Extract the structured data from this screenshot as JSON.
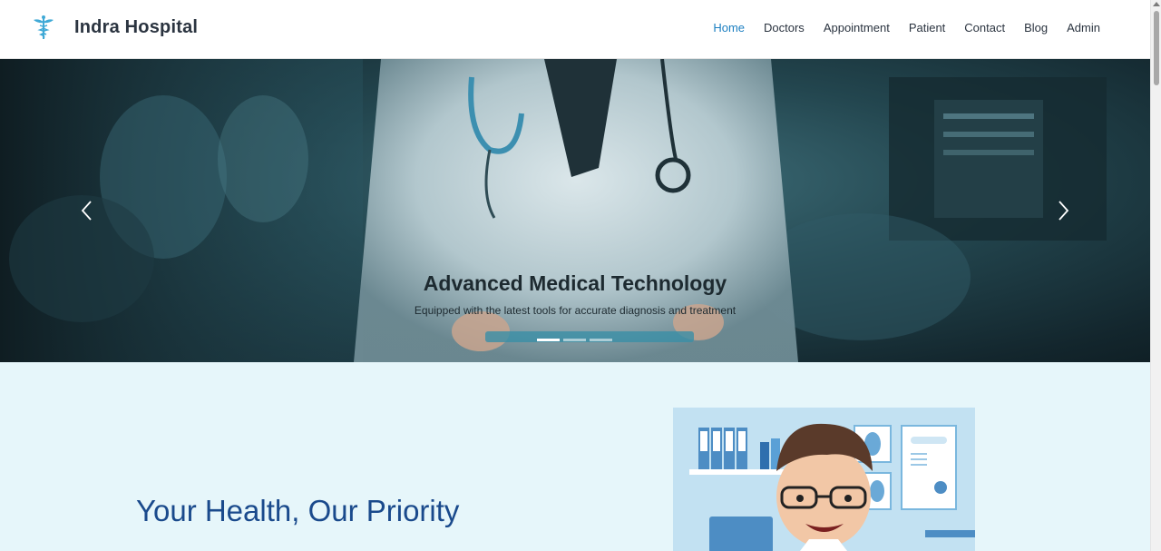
{
  "brand": {
    "name": "Indra Hospital",
    "logo_icon": "caduceus-icon"
  },
  "nav": {
    "items": [
      {
        "label": "Home",
        "active": true
      },
      {
        "label": "Doctors",
        "active": false
      },
      {
        "label": "Appointment",
        "active": false
      },
      {
        "label": "Patient",
        "active": false
      },
      {
        "label": "Contact",
        "active": false
      },
      {
        "label": "Blog",
        "active": false
      },
      {
        "label": "Admin",
        "active": false
      }
    ]
  },
  "carousel": {
    "caption_title": "Advanced Medical Technology",
    "caption_text": "Equipped with the latest tools for accurate diagnosis and treatment",
    "slide_count": 3,
    "active_index": 0,
    "prev_icon": "chevron-left-icon",
    "next_icon": "chevron-right-icon"
  },
  "intro": {
    "title": "Your Health, Our Priority"
  },
  "colors": {
    "accent": "#1c7fc1",
    "heading": "#1a4a8c",
    "section_bg": "#e6f6fa"
  }
}
